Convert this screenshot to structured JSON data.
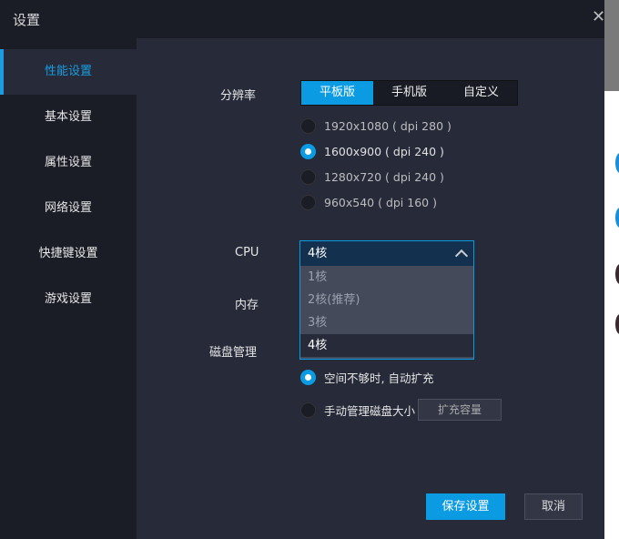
{
  "window": {
    "title": "设置"
  },
  "sidebar": {
    "items": [
      {
        "label": "性能设置"
      },
      {
        "label": "基本设置"
      },
      {
        "label": "属性设置"
      },
      {
        "label": "网络设置"
      },
      {
        "label": "快捷键设置"
      },
      {
        "label": "游戏设置"
      }
    ]
  },
  "resolution": {
    "label": "分辨率",
    "tabs": [
      "平板版",
      "手机版",
      "自定义"
    ],
    "active_tab": "平板版",
    "options": [
      "1920x1080 ( dpi 280 )",
      "1600x900 ( dpi 240 )",
      "1280x720 ( dpi 240 )",
      "960x540 ( dpi 160 )"
    ],
    "selected": "1600x900 ( dpi 240 )"
  },
  "cpu": {
    "label": "CPU",
    "value": "4核",
    "options": [
      "1核",
      "2核(推荐)",
      "3核",
      "4核"
    ]
  },
  "memory": {
    "label": "内存"
  },
  "disk": {
    "label": "磁盘管理",
    "options": [
      "空间不够时, 自动扩充",
      "手动管理磁盘大小"
    ],
    "selected": "空间不够时, 自动扩充",
    "expand_button": "扩充容量"
  },
  "footer": {
    "save": "保存设置",
    "cancel": "取消"
  },
  "colors": {
    "accent": "#0a9be3",
    "bg": "#262a39",
    "sidebar": "#1a1d26"
  }
}
